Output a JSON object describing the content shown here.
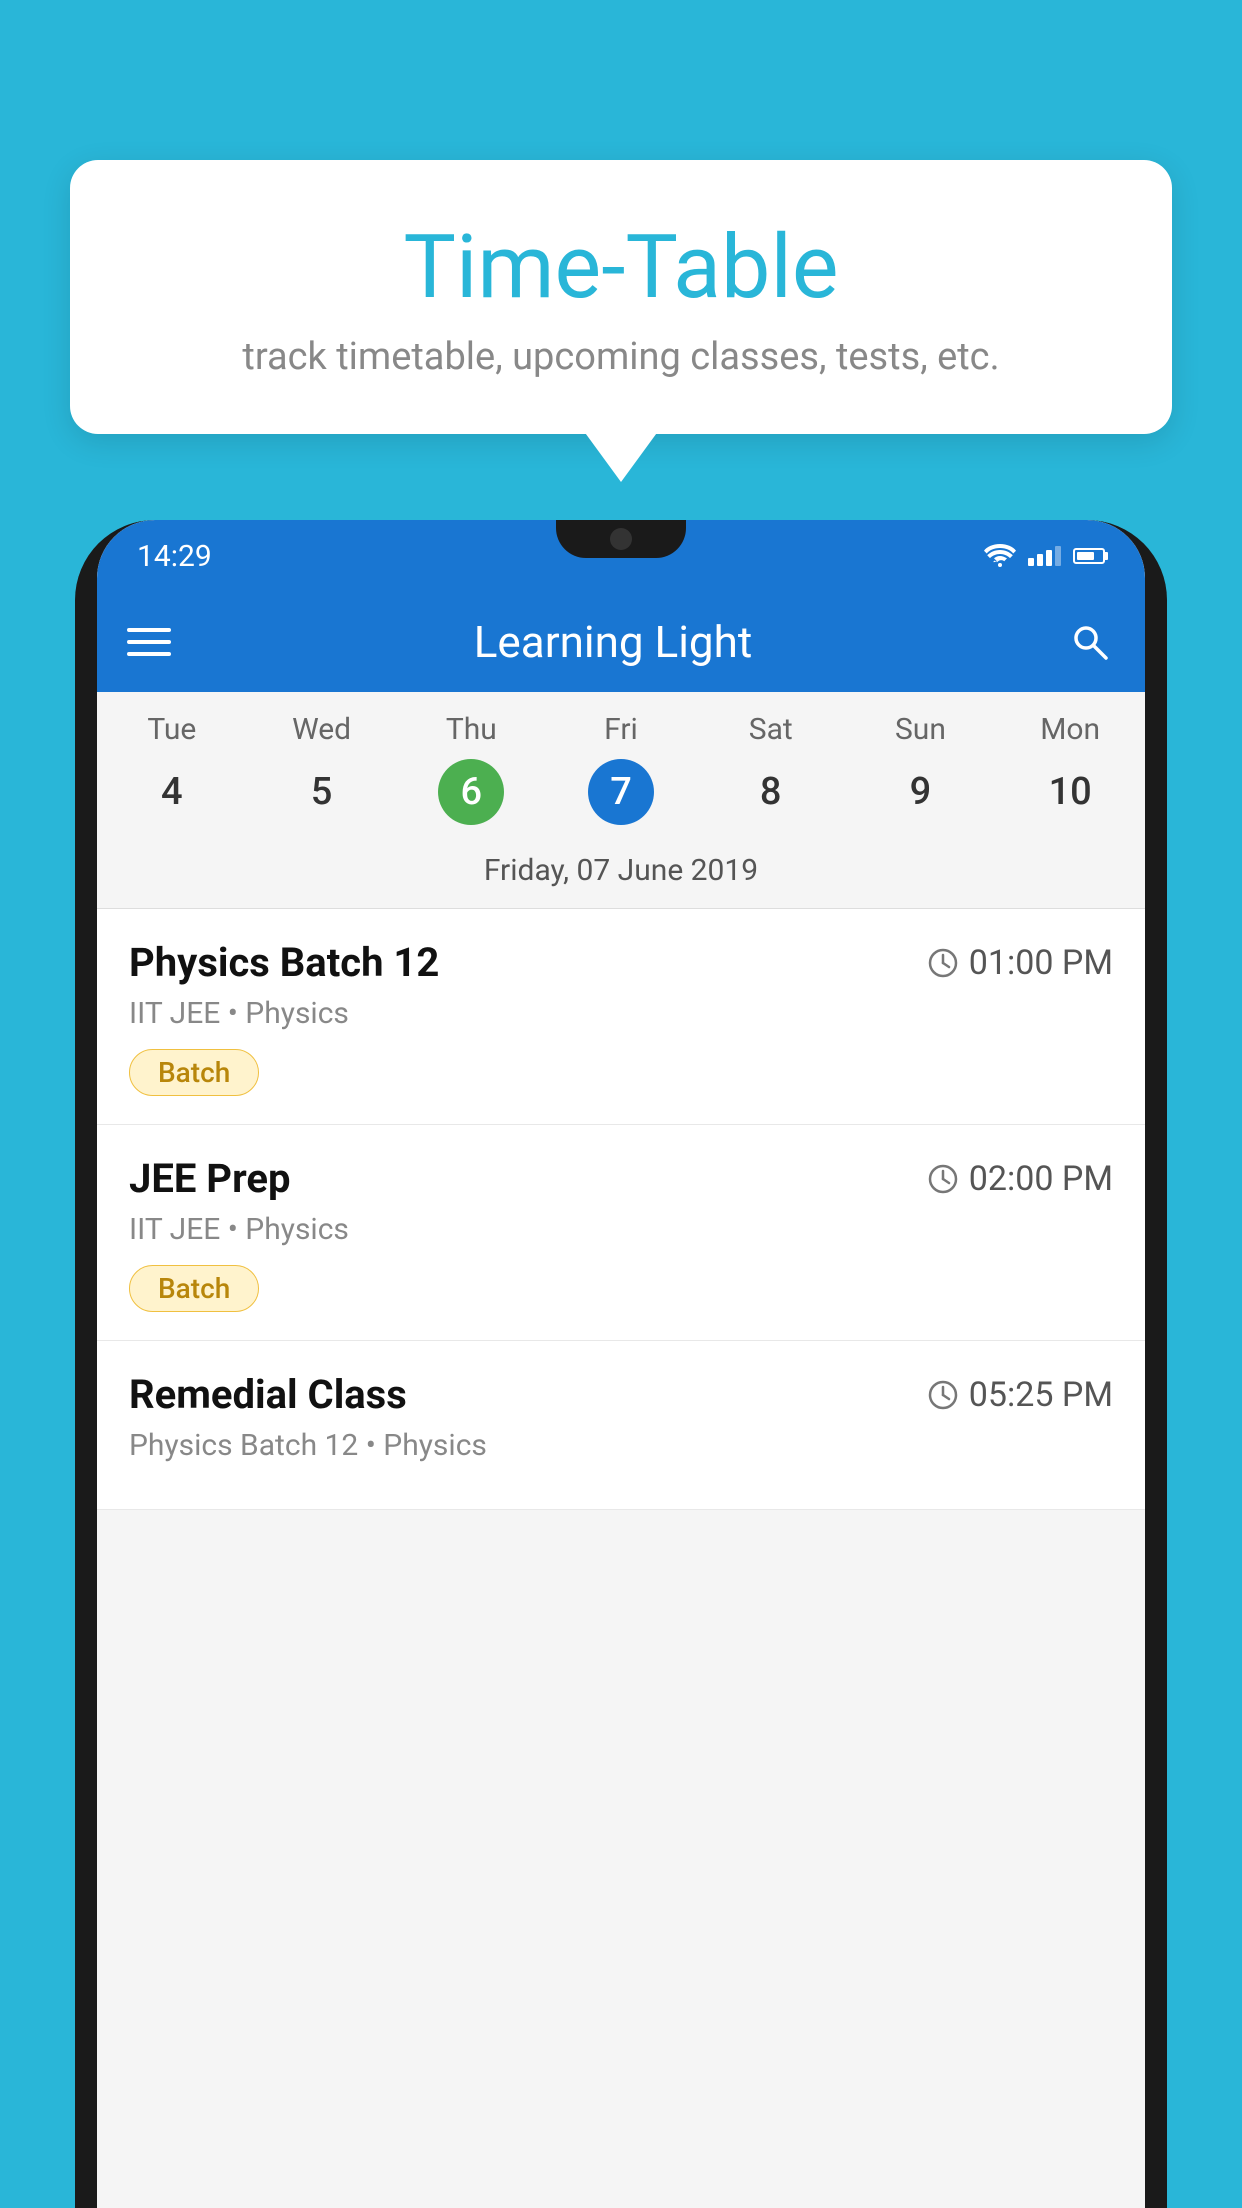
{
  "background_color": "#29B6D8",
  "speech_bubble": {
    "title": "Time-Table",
    "subtitle": "track timetable, upcoming classes, tests, etc."
  },
  "phone": {
    "status_bar": {
      "time": "14:29"
    },
    "app_bar": {
      "title": "Learning Light"
    },
    "calendar": {
      "days": [
        {
          "name": "Tue",
          "number": "4",
          "state": "normal"
        },
        {
          "name": "Wed",
          "number": "5",
          "state": "normal"
        },
        {
          "name": "Thu",
          "number": "6",
          "state": "today"
        },
        {
          "name": "Fri",
          "number": "7",
          "state": "selected"
        },
        {
          "name": "Sat",
          "number": "8",
          "state": "normal"
        },
        {
          "name": "Sun",
          "number": "9",
          "state": "normal"
        },
        {
          "name": "Mon",
          "number": "10",
          "state": "normal"
        }
      ],
      "selected_date_label": "Friday, 07 June 2019"
    },
    "schedule": [
      {
        "name": "Physics Batch 12",
        "time": "01:00 PM",
        "meta": "IIT JEE • Physics",
        "badge": "Batch"
      },
      {
        "name": "JEE Prep",
        "time": "02:00 PM",
        "meta": "IIT JEE • Physics",
        "badge": "Batch"
      },
      {
        "name": "Remedial Class",
        "time": "05:25 PM",
        "meta": "Physics Batch 12 • Physics",
        "badge": null
      }
    ]
  }
}
